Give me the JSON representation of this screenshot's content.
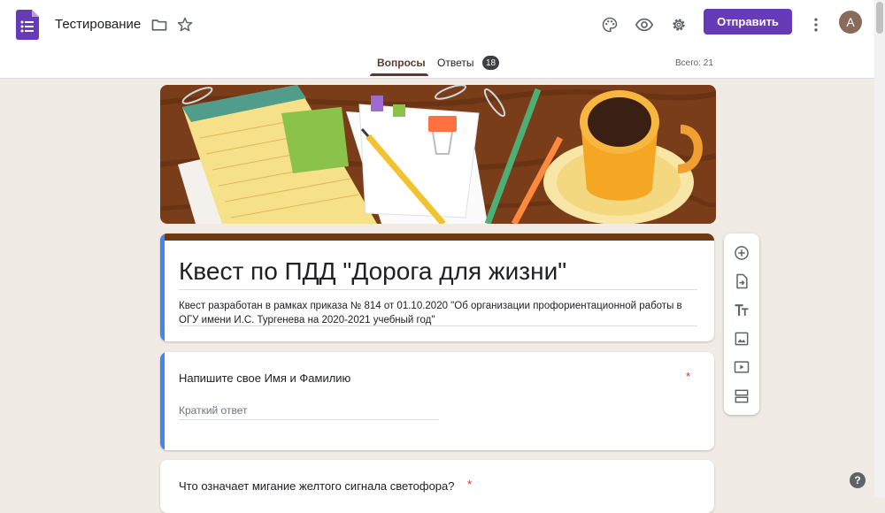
{
  "header": {
    "app_icon": "google-forms-icon",
    "doc_title": "Тестирование",
    "icons": [
      "folder-icon",
      "star-icon",
      "palette-icon",
      "eye-icon",
      "gear-icon",
      "more-vert-icon"
    ],
    "send_label": "Отправить",
    "avatar_letter": "A"
  },
  "tabs": {
    "questions_label": "Вопросы",
    "responses_label": "Ответы",
    "responses_count": "18",
    "total_label": "Всего: 21"
  },
  "form": {
    "title": "Квест по ПДД \"Дорога для жизни\"",
    "description": "Квест разработан в рамках приказа № 814 от 01.10.2020 \"Об организации профориентационной работы в ОГУ имени И.С. Тургенева на 2020-2021 учебный год\""
  },
  "questions": [
    {
      "title": "Напишите свое Имя и Фамилию",
      "required_mark": "*",
      "placeholder": "Краткий ответ"
    },
    {
      "title": "Что означает мигание желтого сигнала светофора?",
      "required_mark": "*"
    }
  ],
  "toolbar": {
    "items": [
      "add-question-icon",
      "import-questions-icon",
      "title-text-icon",
      "image-icon",
      "video-icon",
      "section-icon"
    ]
  },
  "help_label": "?",
  "colors": {
    "accent": "#673ab7",
    "page_bg": "#f1ebe5",
    "header_stripe": "#6d3a16",
    "focus_accent": "#4285f4",
    "required": "#d93025"
  }
}
